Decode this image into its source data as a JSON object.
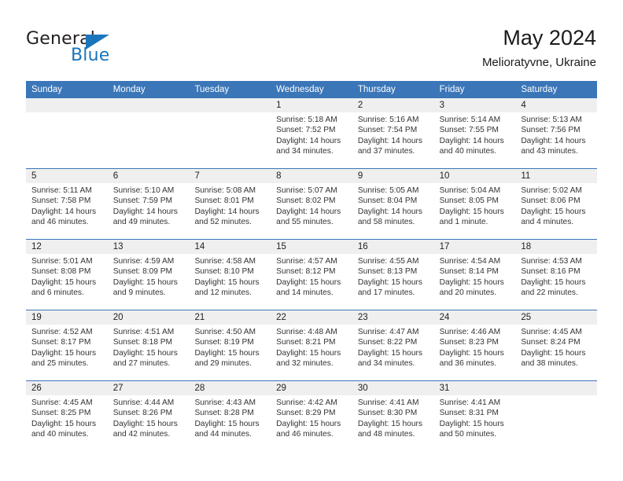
{
  "brand": {
    "name_part1": "General",
    "name_part2": "Blue",
    "accent_color": "#1b75bb"
  },
  "header": {
    "title": "May 2024",
    "subtitle": "Melioratyvne, Ukraine"
  },
  "theme": {
    "header_row_color": "#3a76b8",
    "daynum_band_color": "#efefef",
    "text_color": "#333333"
  },
  "weekdays": [
    "Sunday",
    "Monday",
    "Tuesday",
    "Wednesday",
    "Thursday",
    "Friday",
    "Saturday"
  ],
  "weeks": [
    [
      {
        "day": "",
        "lines": []
      },
      {
        "day": "",
        "lines": []
      },
      {
        "day": "",
        "lines": []
      },
      {
        "day": "1",
        "lines": [
          "Sunrise: 5:18 AM",
          "Sunset: 7:52 PM",
          "Daylight: 14 hours",
          "and 34 minutes."
        ]
      },
      {
        "day": "2",
        "lines": [
          "Sunrise: 5:16 AM",
          "Sunset: 7:54 PM",
          "Daylight: 14 hours",
          "and 37 minutes."
        ]
      },
      {
        "day": "3",
        "lines": [
          "Sunrise: 5:14 AM",
          "Sunset: 7:55 PM",
          "Daylight: 14 hours",
          "and 40 minutes."
        ]
      },
      {
        "day": "4",
        "lines": [
          "Sunrise: 5:13 AM",
          "Sunset: 7:56 PM",
          "Daylight: 14 hours",
          "and 43 minutes."
        ]
      }
    ],
    [
      {
        "day": "5",
        "lines": [
          "Sunrise: 5:11 AM",
          "Sunset: 7:58 PM",
          "Daylight: 14 hours",
          "and 46 minutes."
        ]
      },
      {
        "day": "6",
        "lines": [
          "Sunrise: 5:10 AM",
          "Sunset: 7:59 PM",
          "Daylight: 14 hours",
          "and 49 minutes."
        ]
      },
      {
        "day": "7",
        "lines": [
          "Sunrise: 5:08 AM",
          "Sunset: 8:01 PM",
          "Daylight: 14 hours",
          "and 52 minutes."
        ]
      },
      {
        "day": "8",
        "lines": [
          "Sunrise: 5:07 AM",
          "Sunset: 8:02 PM",
          "Daylight: 14 hours",
          "and 55 minutes."
        ]
      },
      {
        "day": "9",
        "lines": [
          "Sunrise: 5:05 AM",
          "Sunset: 8:04 PM",
          "Daylight: 14 hours",
          "and 58 minutes."
        ]
      },
      {
        "day": "10",
        "lines": [
          "Sunrise: 5:04 AM",
          "Sunset: 8:05 PM",
          "Daylight: 15 hours",
          "and 1 minute."
        ]
      },
      {
        "day": "11",
        "lines": [
          "Sunrise: 5:02 AM",
          "Sunset: 8:06 PM",
          "Daylight: 15 hours",
          "and 4 minutes."
        ]
      }
    ],
    [
      {
        "day": "12",
        "lines": [
          "Sunrise: 5:01 AM",
          "Sunset: 8:08 PM",
          "Daylight: 15 hours",
          "and 6 minutes."
        ]
      },
      {
        "day": "13",
        "lines": [
          "Sunrise: 4:59 AM",
          "Sunset: 8:09 PM",
          "Daylight: 15 hours",
          "and 9 minutes."
        ]
      },
      {
        "day": "14",
        "lines": [
          "Sunrise: 4:58 AM",
          "Sunset: 8:10 PM",
          "Daylight: 15 hours",
          "and 12 minutes."
        ]
      },
      {
        "day": "15",
        "lines": [
          "Sunrise: 4:57 AM",
          "Sunset: 8:12 PM",
          "Daylight: 15 hours",
          "and 14 minutes."
        ]
      },
      {
        "day": "16",
        "lines": [
          "Sunrise: 4:55 AM",
          "Sunset: 8:13 PM",
          "Daylight: 15 hours",
          "and 17 minutes."
        ]
      },
      {
        "day": "17",
        "lines": [
          "Sunrise: 4:54 AM",
          "Sunset: 8:14 PM",
          "Daylight: 15 hours",
          "and 20 minutes."
        ]
      },
      {
        "day": "18",
        "lines": [
          "Sunrise: 4:53 AM",
          "Sunset: 8:16 PM",
          "Daylight: 15 hours",
          "and 22 minutes."
        ]
      }
    ],
    [
      {
        "day": "19",
        "lines": [
          "Sunrise: 4:52 AM",
          "Sunset: 8:17 PM",
          "Daylight: 15 hours",
          "and 25 minutes."
        ]
      },
      {
        "day": "20",
        "lines": [
          "Sunrise: 4:51 AM",
          "Sunset: 8:18 PM",
          "Daylight: 15 hours",
          "and 27 minutes."
        ]
      },
      {
        "day": "21",
        "lines": [
          "Sunrise: 4:50 AM",
          "Sunset: 8:19 PM",
          "Daylight: 15 hours",
          "and 29 minutes."
        ]
      },
      {
        "day": "22",
        "lines": [
          "Sunrise: 4:48 AM",
          "Sunset: 8:21 PM",
          "Daylight: 15 hours",
          "and 32 minutes."
        ]
      },
      {
        "day": "23",
        "lines": [
          "Sunrise: 4:47 AM",
          "Sunset: 8:22 PM",
          "Daylight: 15 hours",
          "and 34 minutes."
        ]
      },
      {
        "day": "24",
        "lines": [
          "Sunrise: 4:46 AM",
          "Sunset: 8:23 PM",
          "Daylight: 15 hours",
          "and 36 minutes."
        ]
      },
      {
        "day": "25",
        "lines": [
          "Sunrise: 4:45 AM",
          "Sunset: 8:24 PM",
          "Daylight: 15 hours",
          "and 38 minutes."
        ]
      }
    ],
    [
      {
        "day": "26",
        "lines": [
          "Sunrise: 4:45 AM",
          "Sunset: 8:25 PM",
          "Daylight: 15 hours",
          "and 40 minutes."
        ]
      },
      {
        "day": "27",
        "lines": [
          "Sunrise: 4:44 AM",
          "Sunset: 8:26 PM",
          "Daylight: 15 hours",
          "and 42 minutes."
        ]
      },
      {
        "day": "28",
        "lines": [
          "Sunrise: 4:43 AM",
          "Sunset: 8:28 PM",
          "Daylight: 15 hours",
          "and 44 minutes."
        ]
      },
      {
        "day": "29",
        "lines": [
          "Sunrise: 4:42 AM",
          "Sunset: 8:29 PM",
          "Daylight: 15 hours",
          "and 46 minutes."
        ]
      },
      {
        "day": "30",
        "lines": [
          "Sunrise: 4:41 AM",
          "Sunset: 8:30 PM",
          "Daylight: 15 hours",
          "and 48 minutes."
        ]
      },
      {
        "day": "31",
        "lines": [
          "Sunrise: 4:41 AM",
          "Sunset: 8:31 PM",
          "Daylight: 15 hours",
          "and 50 minutes."
        ]
      },
      {
        "day": "",
        "lines": []
      }
    ]
  ]
}
